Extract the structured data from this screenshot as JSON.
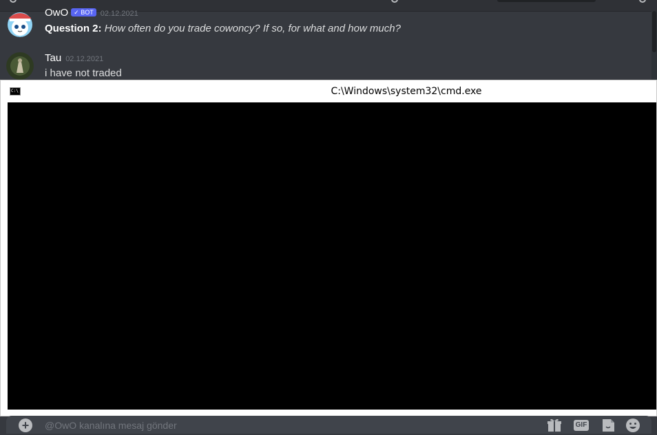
{
  "messages": [
    {
      "username": "OwO",
      "badge": "✓ BOT",
      "timestamp": "02.12.2021",
      "question_label": "Question 2:",
      "question_text": "How often do you trade cowoncy? If so, for what and how much?"
    },
    {
      "username": "Tau",
      "timestamp": "02.12.2021",
      "text": "i have not traded"
    }
  ],
  "cmd_window": {
    "icon_text": "C:\\",
    "title": "C:\\Windows\\system32\\cmd.exe"
  },
  "input": {
    "plus_label": "+",
    "placeholder": "@OwO kanalına mesaj gönder"
  },
  "toolbar_icons": [
    "gift-icon",
    "gif-icon",
    "sticker-icon",
    "emoji-icon"
  ],
  "gif_label": "GIF",
  "colors": {
    "background": "#36393f",
    "bot_badge": "#5865f2",
    "console": "#000000"
  }
}
